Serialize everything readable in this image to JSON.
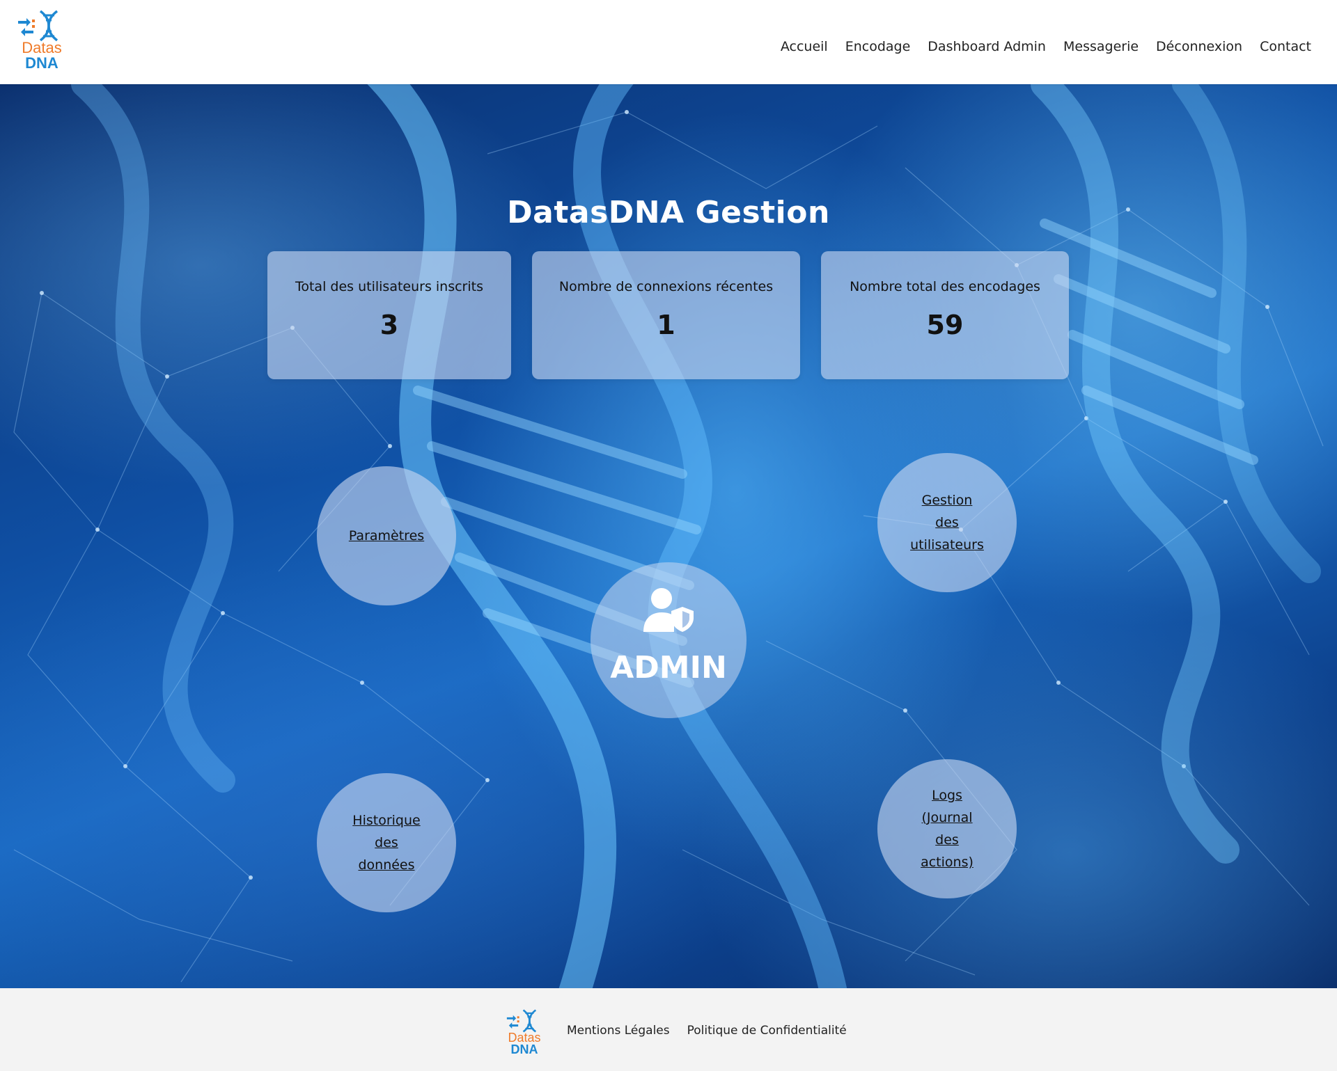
{
  "brand": {
    "logo_line1": "Datas",
    "logo_line2": "DNA",
    "logo_icon": "dna-transfer-logo-icon",
    "color_orange": "#ef7b2a",
    "color_blue": "#1e88d2"
  },
  "nav": {
    "items": [
      "Accueil",
      "Encodage",
      "Dashboard Admin",
      "Messagerie",
      "Déconnexion",
      "Contact"
    ]
  },
  "hero": {
    "title": "DatasDNA Gestion",
    "stats": [
      {
        "label": "Total des utilisateurs inscrits",
        "value": "3"
      },
      {
        "label": "Nombre de connexions récentes",
        "value": "1"
      },
      {
        "label": "Nombre total des encodages",
        "value": "59"
      }
    ],
    "links": {
      "parametres": "Paramètres",
      "gestion_utilisateurs": "Gestion des utilisateurs",
      "historique": "Historique des données",
      "logs": "Logs (Journal des actions)"
    },
    "admin": {
      "label": "ADMIN",
      "icon": "user-shield-icon"
    }
  },
  "footer": {
    "logo_line1": "Datas",
    "logo_line2": "DNA",
    "links": [
      "Mentions Légales",
      "Politique de Confidentialité"
    ]
  }
}
